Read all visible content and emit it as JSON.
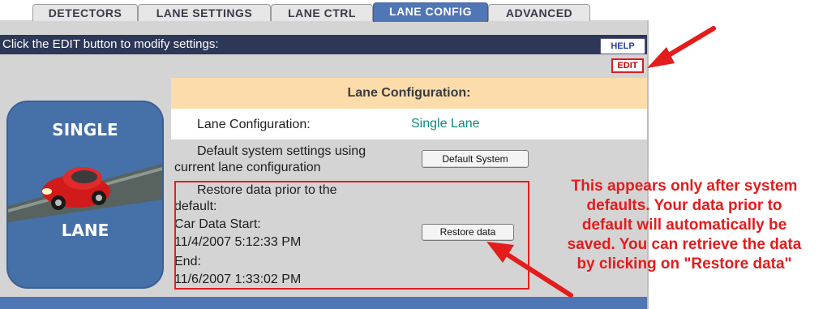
{
  "tabs": [
    "DETECTORS",
    "LANE SETTINGS",
    "LANE CTRL",
    "LANE CONFIG",
    "ADVANCED"
  ],
  "active_tab": "LANE CONFIG",
  "header": {
    "instruction": "Click the EDIT button to modify settings:"
  },
  "buttons": {
    "help": "HELP",
    "edit": "EDIT"
  },
  "side_image": {
    "top_text": "SINGLE",
    "bottom_text": "LANE"
  },
  "lane_config": {
    "title": "Lane Configuration:",
    "config_label": "Lane Configuration:",
    "config_value": "Single Lane",
    "default_label_line1": "Default system settings using",
    "default_label_line2": "current lane configuration",
    "default_button": "Default System",
    "restore_line1": "Restore data prior to the",
    "restore_line2": "default:",
    "car_start_label": "Car Data Start:",
    "car_start_value": "11/4/2007 5:12:33 PM",
    "end_label": "End:",
    "end_value": "11/6/2007 1:33:02 PM",
    "restore_button": "Restore data"
  },
  "annotation": {
    "lines": [
      "This appears only after system",
      "defaults. Your data prior to",
      "default will automatically be",
      "saved. You can retrieve the data",
      "by clicking on \"Restore data\""
    ]
  },
  "colors": {
    "header_bar": "#2d3757",
    "active_tab": "#4f76b5",
    "annotation": "#e31c1c",
    "config_value": "#0a8a7a"
  }
}
